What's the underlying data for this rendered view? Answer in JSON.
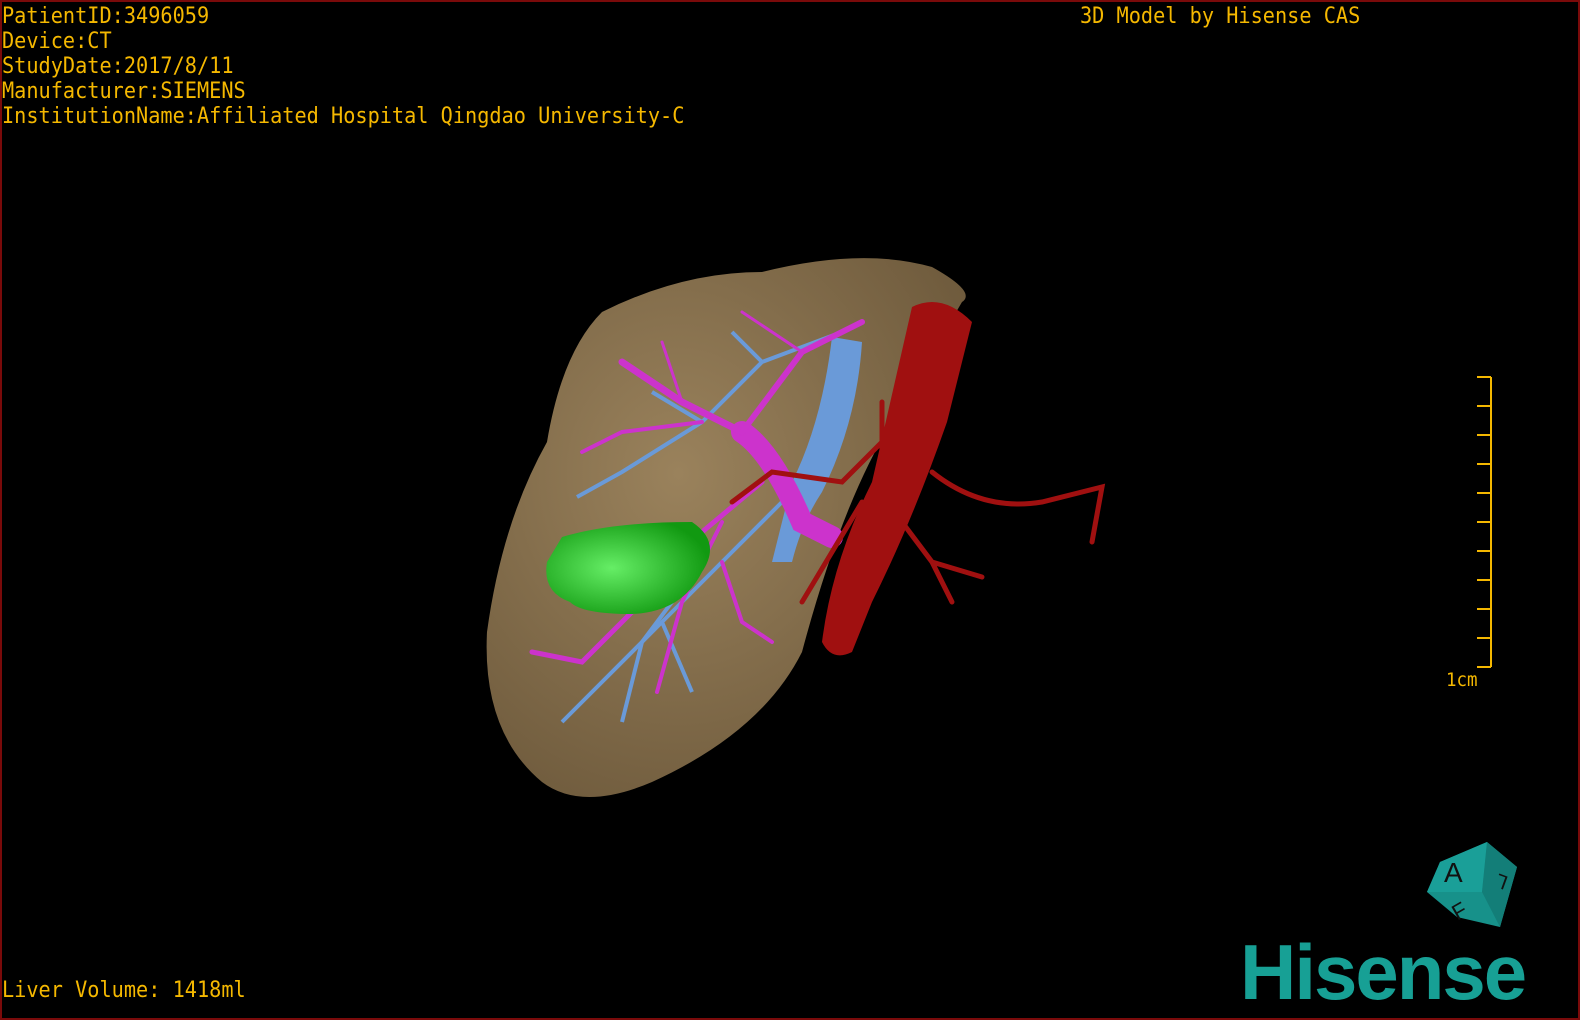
{
  "patient_info": {
    "patient_id": "PatientID:3496059",
    "device": "Device:CT",
    "study_date": "StudyDate:2017/8/11",
    "manufacturer": "Manufacturer:SIEMENS",
    "institution": "InstitutionName:Affiliated Hospital Qingdao University-C"
  },
  "header_right": "3D Model by Hisense CAS",
  "liver_volume": "Liver Volume: 1418ml",
  "scale_bar": {
    "label": "1cm"
  },
  "orientation_cube": {
    "faces": [
      "A",
      "L",
      "F"
    ],
    "color": "#17918a"
  },
  "logo": "Hisense",
  "colors": {
    "overlay_text": "#f5b800",
    "liver": "#8a7250",
    "portal_vein": "#cc33cc",
    "hepatic_vein": "#6a9ad8",
    "artery_aorta": "#a01010",
    "lesion": "#22aa22",
    "logo": "#17a095"
  }
}
